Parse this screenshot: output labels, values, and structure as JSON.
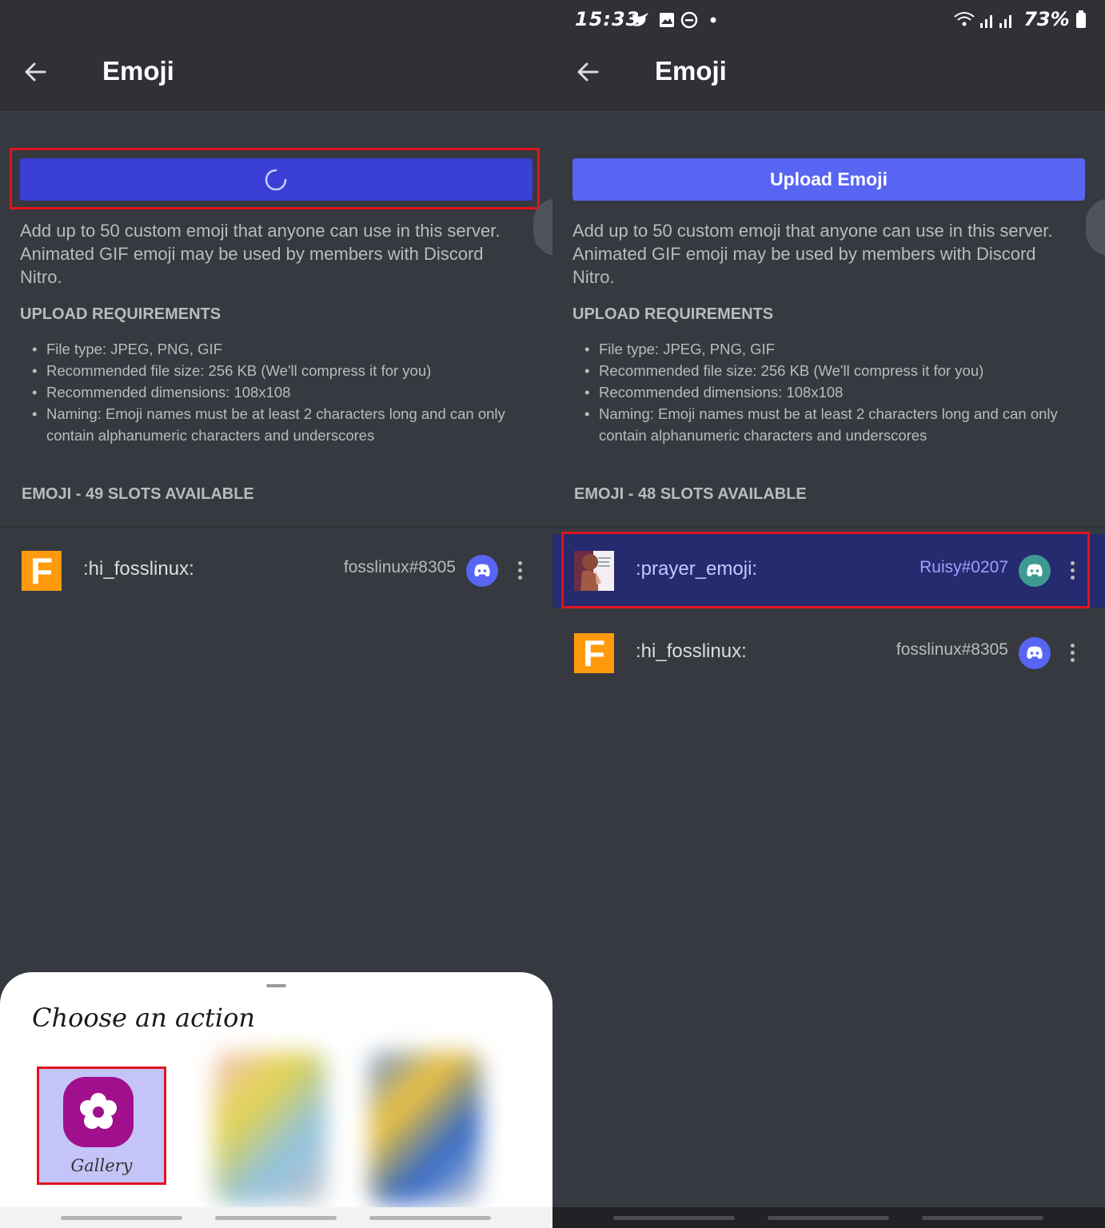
{
  "left": {
    "header": {
      "title": "Emoji"
    },
    "upload_button": {
      "state": "loading"
    },
    "description": "Add up to 50 custom emoji that anyone can use in this server. Animated GIF emoji may be used by members with Discord Nitro.",
    "requirements_heading": "UPLOAD REQUIREMENTS",
    "requirements": [
      "File type: JPEG, PNG, GIF",
      "Recommended file size: 256 KB (We'll compress it for you)",
      "Recommended dimensions: 108x108",
      "Naming: Emoji names must be at least 2 characters long and can only contain alphanumeric characters and underscores"
    ],
    "slots_label": "EMOJI - 49 SLOTS AVAILABLE",
    "emojis": [
      {
        "name": ":hi_fosslinux:",
        "uploader": "fosslinux#8305",
        "icon_letter": "F"
      }
    ],
    "sheet": {
      "title": "Choose an action",
      "apps": [
        {
          "label": "Gallery",
          "icon": "gallery-flower-icon"
        }
      ]
    }
  },
  "right": {
    "status_bar": {
      "time": "15:33",
      "battery": "73%"
    },
    "header": {
      "title": "Emoji"
    },
    "upload_button": {
      "label": "Upload Emoji"
    },
    "description": "Add up to 50 custom emoji that anyone can use in this server. Animated GIF emoji may be used by members with Discord Nitro.",
    "requirements_heading": "UPLOAD REQUIREMENTS",
    "requirements": [
      "File type: JPEG, PNG, GIF",
      "Recommended file size: 256 KB (We'll compress it for you)",
      "Recommended dimensions: 108x108",
      "Naming: Emoji names must be at least 2 characters long and can only contain alphanumeric characters and underscores"
    ],
    "slots_label": "EMOJI - 48 SLOTS AVAILABLE",
    "emojis": [
      {
        "name": ":prayer_emoji:",
        "uploader": "Ruisy#0207"
      },
      {
        "name": ":hi_fosslinux:",
        "uploader": "fosslinux#8305",
        "icon_letter": "F"
      }
    ]
  },
  "colors": {
    "brand": "#5865f2",
    "background": "#36393f",
    "header": "#2f3136",
    "highlight": "#262a6e",
    "annotation": "#e0141e"
  }
}
